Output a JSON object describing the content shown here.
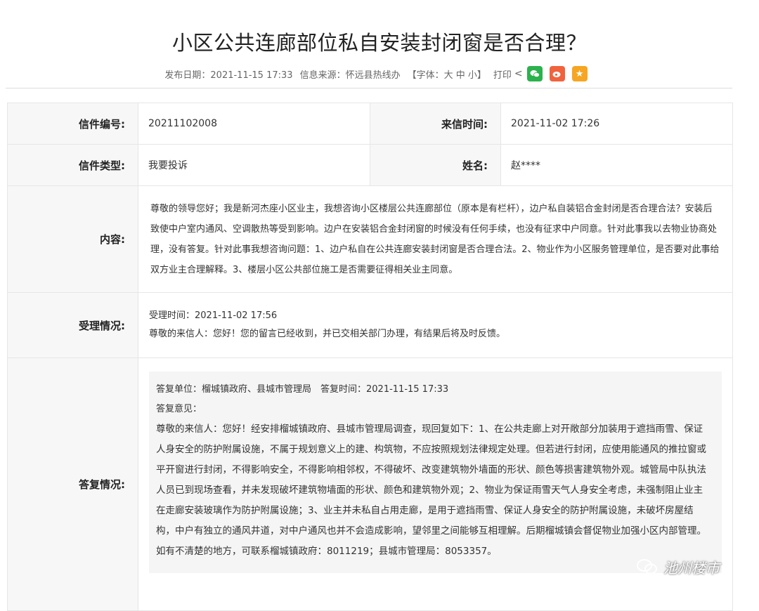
{
  "article": {
    "title": "小区公共连廊部位私自安装封闭窗是否合理？",
    "publish_date": "发布日期：2021-11-15 17:33",
    "source": "信息来源：怀远县热线办",
    "font_size": "【字体：大 中 小】",
    "print": "打印"
  },
  "share": {
    "icons": [
      "share-icon",
      "wechat-icon",
      "weibo-icon",
      "favorite-icon"
    ],
    "colors": {
      "wechat": "#2bb24c",
      "weibo": "#f0633c",
      "favorite": "#f6a623"
    }
  },
  "letter": {
    "number_label": "信件编号:",
    "number": "20211102008",
    "time_label": "来信时间:",
    "time": "2021-11-02 17:26",
    "type_label": "信件类型:",
    "type": "我要投诉",
    "name_label": "姓名:",
    "name": "赵****",
    "content_label": "内容:",
    "content": "尊敬的领导您好；我是新河杰座小区业主，我想咨询小区楼层公共连廊部位（原本是有栏杆），边户私自装铝合金封闭是否合理合法？安装后致使中户室内通风、空调散热等受到影响。边户在安装铝合金封闭窗的时候没有任何手续，也没有征求中户同意。针对此事我以去物业协商处理，没有答复。针对此事我想咨询问题：1、边户私自在公共连廊安装封闭窗是否合理合法。2、物业作为小区服务管理单位，是否要对此事给双方业主合理解释。3、楼层小区公共部位施工是否需要征得相关业主同意。",
    "accept_label": "受理情况:",
    "accept_time": "受理时间：2021-11-02 17:56",
    "accept_text": "尊敬的来信人：您好！您的留言已经收到，并已交相关部门办理，有结果后将及时反馈。",
    "reply_label": "答复情况:",
    "reply_unit": "答复单位：榴城镇政府、县城市管理局　答复时间：2021-11-15 17:33",
    "reply_opinion_label": "答复意见：",
    "reply_text": "尊敬的来信人：您好！经安排榴城镇政府、县城市管理局调查，现回复如下：1、在公共走廊上对开敞部分加装用于遮挡雨雪、保证人身安全的防护附属设施，不属于规划意义上的建、构筑物，不应按照规划法律规定处理。但若进行封闭，应使用能通风的推拉窗或平开窗进行封闭，不得影响安全，不得影响相邻权，不得破坏、改变建筑物外墙面的形状、颜色等损害建筑物外观。城管局中队执法人员已到现场查看，并未发现破坏建筑物墙面的形状、颜色和建筑物外观；2、物业为保证雨雪天气人身安全考虑，未强制阻止业主在走廊安装玻璃作为防护附属设施；3、业主并未私自占用走廊，是用于遮挡雨雪、保证人身安全的防护附属设施，未破坏房屋结构，中户有独立的通风井道，对中户通风也并不会造成影响，望邻里之间能够互相理解。后期榴城镇会督促物业加强小区内部管理。如有不清楚的地方，可联系榴城镇政府：8011219；县城市管理局：8053357。"
  },
  "watermark": {
    "text": "池州楼市"
  }
}
